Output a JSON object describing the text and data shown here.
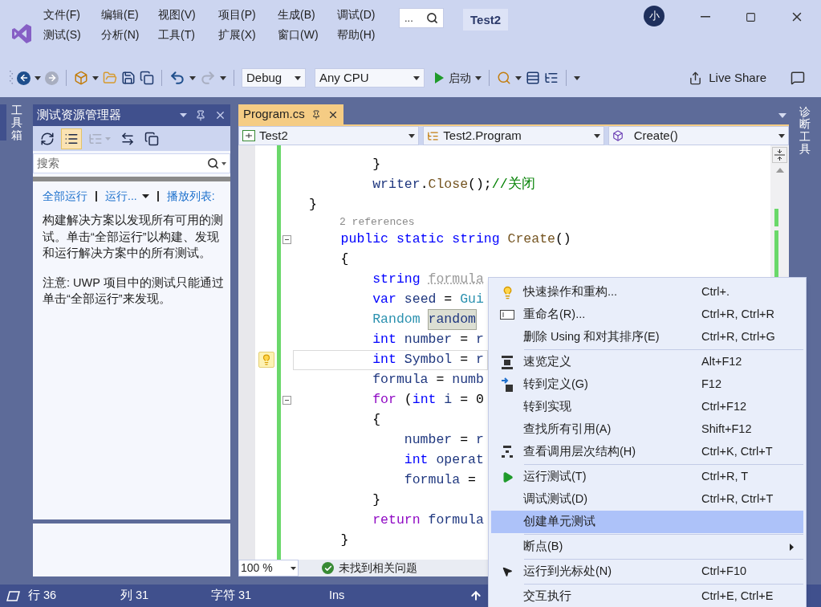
{
  "title_bar": {
    "menu": [
      "文件(F)",
      "编辑(E)",
      "视图(V)",
      "项目(P)",
      "生成(B)",
      "调试(D)",
      "测试(S)",
      "分析(N)",
      "工具(T)",
      "扩展(X)",
      "窗口(W)",
      "帮助(H)"
    ],
    "search": {
      "placeholder": "..."
    },
    "solution_name": "Test2",
    "avatar": "小"
  },
  "toolbar": {
    "configuration": "Debug",
    "platform": "Any CPU",
    "start_label": "启动",
    "live_share": "Live Share"
  },
  "side_tabs": {
    "left": "工具箱",
    "right": "诊断工具"
  },
  "test_explorer": {
    "title": "测试资源管理器",
    "tools": [
      {
        "pressed": false,
        "disabled": false
      },
      {
        "pressed": true,
        "disabled": false
      },
      {
        "pressed": false,
        "disabled": true
      },
      {
        "pressed": false,
        "disabled": false
      },
      {
        "pressed": false,
        "disabled": false
      }
    ],
    "search": {
      "placeholder": "搜索"
    },
    "links": [
      {
        "label": "全部运行",
        "dropdown": false
      },
      {
        "label": "运行...",
        "dropdown": true
      },
      {
        "label": "播放列表:",
        "dropdown": false
      }
    ],
    "paragraphs": [
      "构建解决方案以发现所有可用的测试。单击“全部运行”以构建、发现和运行解决方案中的所有测试。",
      "注意: UWP 项目中的测试只能通过单击“全部运行”来发现。"
    ]
  },
  "editor": {
    "tabs": [
      {
        "label": "Program.cs",
        "selected": true
      }
    ],
    "nav": [
      "Test2",
      "Test2.Program",
      "Create()"
    ],
    "lines": [
      {
        "kind": "code",
        "current": false,
        "bulb": false,
        "fold": false,
        "tokens": [
          {
            "text": "        }",
            "kind": "plain"
          }
        ]
      },
      {
        "kind": "code",
        "current": false,
        "bulb": false,
        "fold": false,
        "tokens": [
          {
            "text": "        writer",
            "kind": "name"
          },
          {
            "text": ".",
            "kind": "plain"
          },
          {
            "text": "Close",
            "kind": "method"
          },
          {
            "text": "();",
            "kind": "plain"
          },
          {
            "text": "//关闭",
            "kind": "comment"
          }
        ]
      },
      {
        "kind": "code",
        "current": false,
        "bulb": false,
        "fold": false,
        "tokens": [
          {
            "text": "}",
            "kind": "plain"
          }
        ]
      },
      {
        "kind": "codelens",
        "current": false,
        "bulb": false,
        "fold": false,
        "tokens": [
          {
            "text": "2 references",
            "kind": "plain"
          }
        ]
      },
      {
        "kind": "code",
        "current": false,
        "bulb": false,
        "fold": true,
        "tokens": [
          {
            "text": "    public static string ",
            "kind": "keyword"
          },
          {
            "text": "Create",
            "kind": "method"
          },
          {
            "text": "()",
            "kind": "plain"
          }
        ]
      },
      {
        "kind": "code",
        "current": false,
        "bulb": false,
        "fold": false,
        "tokens": [
          {
            "text": "    {",
            "kind": "plain"
          }
        ]
      },
      {
        "kind": "code",
        "current": false,
        "bulb": false,
        "fold": false,
        "tokens": [
          {
            "text": "        string ",
            "kind": "keyword"
          },
          {
            "text": "formula",
            "kind": "unused"
          }
        ]
      },
      {
        "kind": "code",
        "current": false,
        "bulb": false,
        "fold": false,
        "tokens": [
          {
            "text": "        var ",
            "kind": "keyword"
          },
          {
            "text": "seed",
            "kind": "name"
          },
          {
            "text": " = ",
            "kind": "plain"
          },
          {
            "text": "Gui",
            "kind": "type"
          }
        ]
      },
      {
        "kind": "code",
        "current": false,
        "bulb": false,
        "fold": false,
        "tokens": [
          {
            "text": "        Random ",
            "kind": "type"
          },
          {
            "text": "random",
            "kind": "highlight"
          }
        ]
      },
      {
        "kind": "code",
        "current": false,
        "bulb": false,
        "fold": false,
        "tokens": [
          {
            "text": "        int ",
            "kind": "keyword"
          },
          {
            "text": "number",
            "kind": "name"
          },
          {
            "text": " = ",
            "kind": "plain"
          },
          {
            "text": "r",
            "kind": "name"
          }
        ]
      },
      {
        "kind": "code",
        "current": true,
        "bulb": true,
        "fold": false,
        "tokens": [
          {
            "text": "        int ",
            "kind": "keyword"
          },
          {
            "text": "Symbol",
            "kind": "name"
          },
          {
            "text": " = ",
            "kind": "plain"
          },
          {
            "text": "r",
            "kind": "name"
          }
        ]
      },
      {
        "kind": "code",
        "current": false,
        "bulb": false,
        "fold": false,
        "tokens": [
          {
            "text": "        formula",
            "kind": "name"
          },
          {
            "text": " = ",
            "kind": "plain"
          },
          {
            "text": "numb",
            "kind": "name"
          }
        ]
      },
      {
        "kind": "code",
        "current": false,
        "bulb": false,
        "fold": true,
        "tokens": [
          {
            "text": "        for",
            "kind": "control"
          },
          {
            "text": " (",
            "kind": "plain"
          },
          {
            "text": "int ",
            "kind": "keyword"
          },
          {
            "text": "i",
            "kind": "name"
          },
          {
            "text": " = 0",
            "kind": "plain"
          }
        ]
      },
      {
        "kind": "code",
        "current": false,
        "bulb": false,
        "fold": false,
        "tokens": [
          {
            "text": "        {",
            "kind": "plain"
          }
        ]
      },
      {
        "kind": "code",
        "current": false,
        "bulb": false,
        "fold": false,
        "tokens": [
          {
            "text": "            number",
            "kind": "name"
          },
          {
            "text": " = ",
            "kind": "plain"
          },
          {
            "text": "r",
            "kind": "name"
          }
        ]
      },
      {
        "kind": "code",
        "current": false,
        "bulb": false,
        "fold": false,
        "tokens": [
          {
            "text": "            int ",
            "kind": "keyword"
          },
          {
            "text": "operat",
            "kind": "name"
          }
        ]
      },
      {
        "kind": "code",
        "current": false,
        "bulb": false,
        "fold": false,
        "tokens": [
          {
            "text": "            formula",
            "kind": "name"
          },
          {
            "text": " =",
            "kind": "plain"
          }
        ]
      },
      {
        "kind": "code",
        "current": false,
        "bulb": false,
        "fold": false,
        "tokens": [
          {
            "text": "        }",
            "kind": "plain"
          }
        ]
      },
      {
        "kind": "code",
        "current": false,
        "bulb": false,
        "fold": false,
        "tokens": [
          {
            "text": "        return ",
            "kind": "control"
          },
          {
            "text": "formula",
            "kind": "name"
          }
        ]
      },
      {
        "kind": "code",
        "current": false,
        "bulb": false,
        "fold": false,
        "tokens": [
          {
            "text": "    }",
            "kind": "plain"
          }
        ]
      }
    ],
    "zoom": "100 %",
    "issues": "未找到相关问题"
  },
  "context_menu": [
    {
      "kind": "item",
      "label": "快速操作和重构...",
      "shortcut": "Ctrl+.",
      "selected": false,
      "submenu": false
    },
    {
      "kind": "item",
      "label": "重命名(R)...",
      "shortcut": "Ctrl+R, Ctrl+R",
      "selected": false,
      "submenu": false
    },
    {
      "kind": "item",
      "label": "删除 Using 和对其排序(E)",
      "shortcut": "Ctrl+R, Ctrl+G",
      "selected": false,
      "submenu": false
    },
    {
      "kind": "separator"
    },
    {
      "kind": "item",
      "label": "速览定义",
      "shortcut": "Alt+F12",
      "selected": false,
      "submenu": false
    },
    {
      "kind": "item",
      "label": "转到定义(G)",
      "shortcut": "F12",
      "selected": false,
      "submenu": false
    },
    {
      "kind": "item",
      "label": "转到实现",
      "shortcut": "Ctrl+F12",
      "selected": false,
      "submenu": false
    },
    {
      "kind": "item",
      "label": "查找所有引用(A)",
      "shortcut": "Shift+F12",
      "selected": false,
      "submenu": false
    },
    {
      "kind": "item",
      "label": "查看调用层次结构(H)",
      "shortcut": "Ctrl+K, Ctrl+T",
      "selected": false,
      "submenu": false
    },
    {
      "kind": "separator"
    },
    {
      "kind": "item",
      "label": "运行测试(T)",
      "shortcut": "Ctrl+R, T",
      "selected": false,
      "submenu": false
    },
    {
      "kind": "item",
      "label": "调试测试(D)",
      "shortcut": "Ctrl+R, Ctrl+T",
      "selected": false,
      "submenu": false
    },
    {
      "kind": "item",
      "label": "创建单元测试",
      "selected": true,
      "submenu": false
    },
    {
      "kind": "separator"
    },
    {
      "kind": "item",
      "label": "断点(B)",
      "selected": false,
      "submenu": true
    },
    {
      "kind": "separator"
    },
    {
      "kind": "item",
      "label": "运行到光标处(N)",
      "shortcut": "Ctrl+F10",
      "selected": false,
      "submenu": false
    },
    {
      "kind": "separator"
    },
    {
      "kind": "item",
      "label": "交互执行",
      "shortcut": "Ctrl+E, Ctrl+E",
      "selected": false,
      "submenu": false
    }
  ],
  "status_bar": {
    "line": "行 36",
    "column": "列 31",
    "char": "字符 31",
    "mode": "Ins"
  }
}
